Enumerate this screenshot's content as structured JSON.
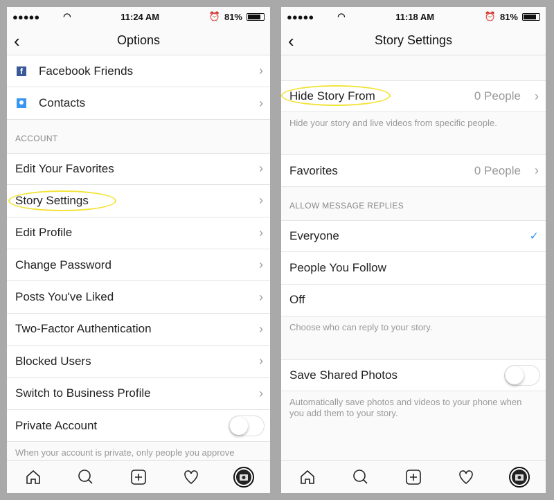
{
  "status_left": {
    "time": "11:24 AM",
    "battery": "81%"
  },
  "status_right": {
    "time": "11:18 AM",
    "battery": "81%"
  },
  "options": {
    "title": "Options",
    "top_items": [
      "Facebook Friends",
      "Contacts"
    ],
    "section": "ACCOUNT",
    "items": [
      "Edit Your Favorites",
      "Story Settings",
      "Edit Profile",
      "Change Password",
      "Posts You've Liked",
      "Two-Factor Authentication",
      "Blocked Users",
      "Switch to Business Profile"
    ],
    "private_label": "Private Account",
    "private_on": false,
    "private_desc": "When your account is private, only people you approve"
  },
  "story": {
    "title": "Story Settings",
    "hide_label": "Hide Story From",
    "hide_value": "0 People",
    "hide_desc": "Hide your story and live videos from specific people.",
    "fav_label": "Favorites",
    "fav_value": "0 People",
    "replies_section": "ALLOW MESSAGE REPLIES",
    "replies": [
      "Everyone",
      "People You Follow",
      "Off"
    ],
    "replies_selected": "Everyone",
    "replies_desc": "Choose who can reply to your story.",
    "save_label": "Save Shared Photos",
    "save_on": false,
    "save_desc": "Automatically save photos and videos to your phone when you add them to your story."
  },
  "colors": {
    "highlight": "#f3e33a",
    "accent": "#3897f0",
    "facebook": "#3b5998"
  }
}
